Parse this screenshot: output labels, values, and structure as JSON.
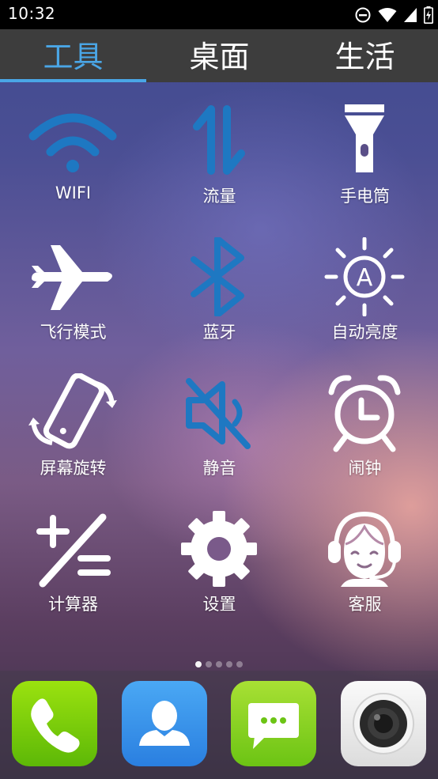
{
  "status_bar": {
    "time": "10:32",
    "icons": [
      "do-not-disturb-icon",
      "wifi-signal-icon",
      "cell-signal-icon",
      "battery-charging-icon"
    ]
  },
  "tabs": [
    {
      "label": "工具",
      "active": true
    },
    {
      "label": "桌面",
      "active": false
    },
    {
      "label": "生活",
      "active": false
    }
  ],
  "tools": [
    {
      "label": "WIFI",
      "icon": "wifi-icon",
      "state": "on"
    },
    {
      "label": "流量",
      "icon": "mobile-data-icon",
      "state": "on"
    },
    {
      "label": "手电筒",
      "icon": "flashlight-icon",
      "state": "off"
    },
    {
      "label": "飞行模式",
      "icon": "airplane-icon",
      "state": "off"
    },
    {
      "label": "蓝牙",
      "icon": "bluetooth-icon",
      "state": "on"
    },
    {
      "label": "自动亮度",
      "icon": "auto-brightness-icon",
      "state": "off"
    },
    {
      "label": "屏幕旋转",
      "icon": "screen-rotation-icon",
      "state": "off"
    },
    {
      "label": "静音",
      "icon": "mute-icon",
      "state": "on"
    },
    {
      "label": "闹钟",
      "icon": "alarm-clock-icon",
      "state": "off"
    },
    {
      "label": "计算器",
      "icon": "calculator-icon",
      "state": "off"
    },
    {
      "label": "设置",
      "icon": "settings-gear-icon",
      "state": "off"
    },
    {
      "label": "客服",
      "icon": "customer-service-icon",
      "state": "off"
    }
  ],
  "pager": {
    "pages": 5,
    "current": 1
  },
  "dock": [
    {
      "app": "phone",
      "icon": "phone-icon",
      "color": "#7ccd0b"
    },
    {
      "app": "contacts",
      "icon": "contacts-icon",
      "color": "#3a93ea"
    },
    {
      "app": "messages",
      "icon": "messages-icon",
      "color": "#8ad224"
    },
    {
      "app": "camera",
      "icon": "camera-icon",
      "color": "#eeeeee"
    }
  ],
  "colors": {
    "accent": "#4aa6e6",
    "active_tool": "#1e78c2",
    "inactive_tool": "#ffffff",
    "tabbar": "#3d3d3d"
  }
}
